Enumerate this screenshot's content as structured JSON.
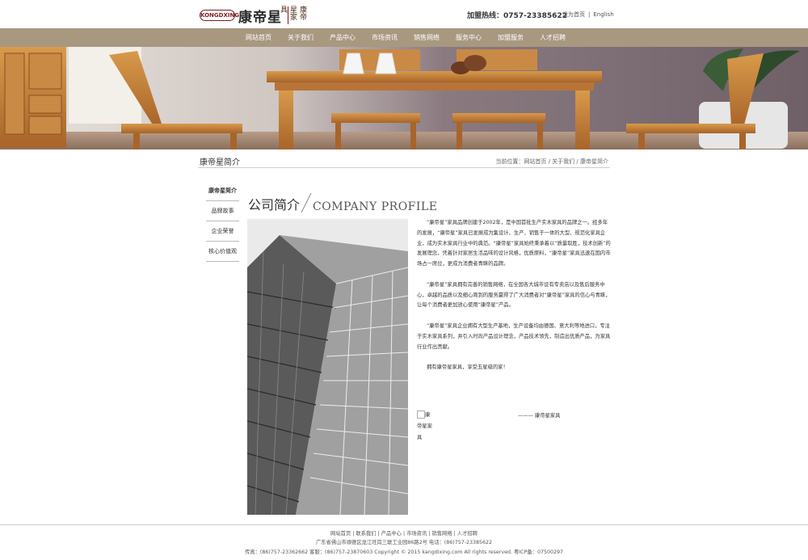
{
  "header": {
    "logo_mark": "KONGDXING",
    "logo_text": "康帝星",
    "logo_seal": "康帝星家具",
    "hotline": "加盟热线：0757-23385622",
    "top_links": [
      "设为首页",
      "|",
      "English"
    ]
  },
  "nav": [
    "网站首页",
    "关于我们",
    "产品中心",
    "市场资讯",
    "销售网络",
    "服务中心",
    "加盟服务",
    "人才招聘"
  ],
  "section": {
    "title": "康帝星简介",
    "breadcrumb": "当前位置：网站首页 / 关于我们 / 康帝星简介"
  },
  "sidebar": [
    "康帝星简介",
    "品牌故事",
    "企业荣誉",
    "核心价值观"
  ],
  "heading": {
    "cn": "公司简介",
    "en": "COMPANY PROFILE"
  },
  "content": {
    "paragraphs": [
      "“康帝星”家具品牌创建于2002年，是中国首批生产实木家具的品牌之一。经多年的发展，“康帝星”家具已发展成为集设计、生产、销售于一体的大型、规范化家具企业，成为实木家具行业中的典范。“康帝星”家具始终秉承着以“质量取胜，技术创新”的发展理念，凭着针对家居生活品味的设计风格，优质原料，“康帝星”家具迅速在国内市场占一席位，更成为消费者青睐的品牌。",
      "“康帝星”家具拥有完善的销售网络，在全国各大城市设有专卖店以及售后服务中心，卓越的品质以及细心周到的服务赢得了广大消费者对“康帝星”家具的信心与青睐，让每个消费者更加放心使用“康帝星”产品。",
      "“康帝星”家具企业拥有大型生产基地，生产设备均由德国、意大利等地进口，专注于实木家具系列，并引入时尚产品设计理念，产品技术领先，制造出优质产品，为家具行业作出贡献。",
      "拥有康帝星家具，享受五星级的家！"
    ],
    "broken_image_alt": [
      "康",
      "帝星家",
      "具"
    ],
    "signature": "——— 康帝星家具"
  },
  "footer": {
    "links": [
      "网站首页",
      "|",
      "联系我们",
      "|",
      "产品中心",
      "|",
      "市场资讯",
      "|",
      "销售网络",
      "|",
      "人才招聘"
    ],
    "address": "广东省佛山市顺德区龙江旺岗三联工业园86路2号    电话：(86)757-23385622",
    "copyright": "传真：(86)757-23362662    客服：(86)757-23870603    Copyright © 2015 kangdixing.com All rights reserved.    粤ICP备：07500297"
  },
  "colors": {
    "nav_bg": "#a89880",
    "brand_red": "#7a1e1e"
  }
}
